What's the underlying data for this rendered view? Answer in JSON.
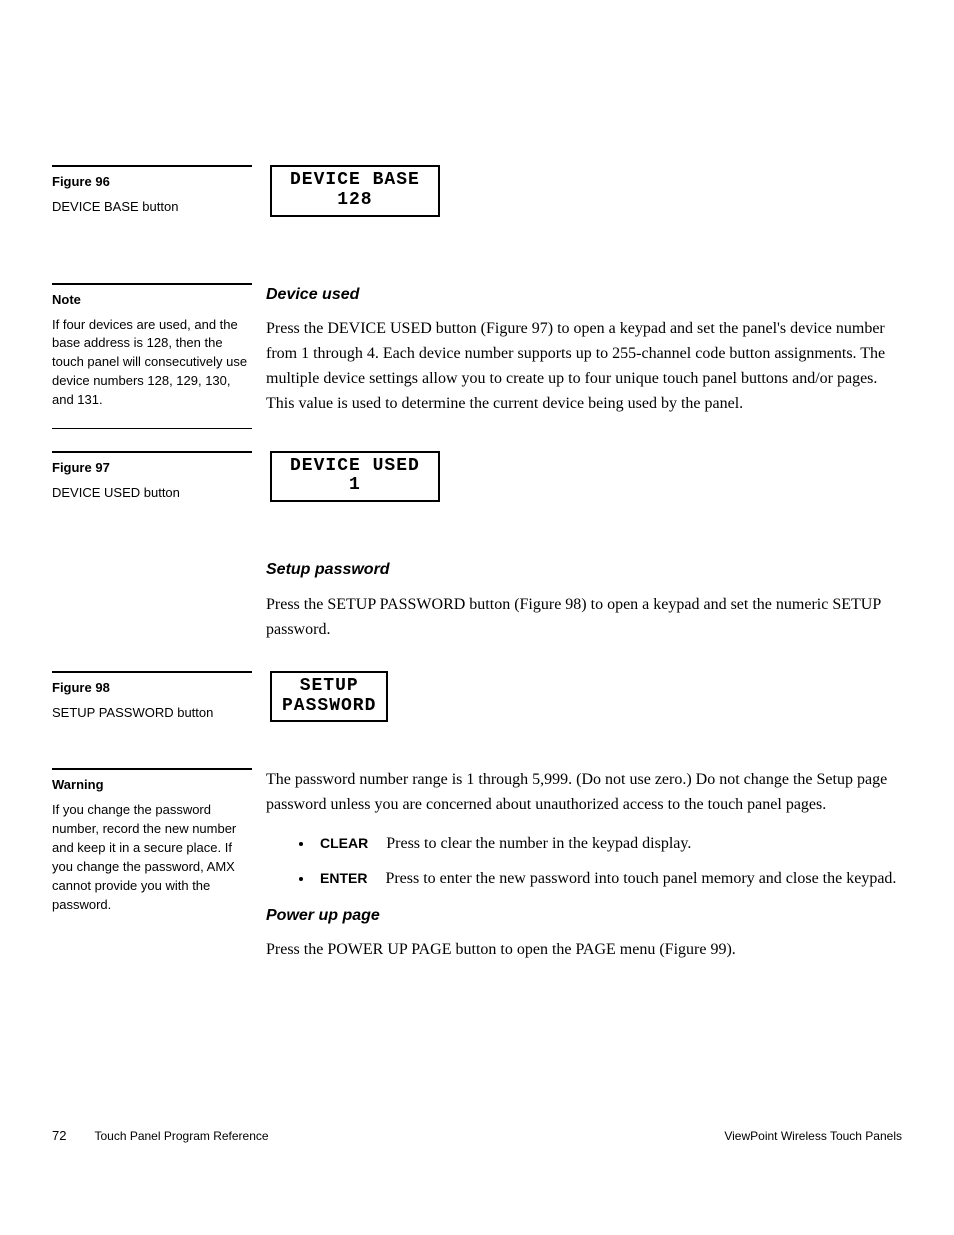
{
  "sidebar": {
    "fig96": {
      "label": "Figure 96",
      "caption": "DEVICE BASE button"
    },
    "note": {
      "label": "Note",
      "text": "If four devices are used, and the base address is 128, then the touch panel will consecutively use device numbers 128, 129, 130, and 131."
    },
    "fig97": {
      "label": "Figure 97",
      "caption": "DEVICE USED button"
    },
    "fig98": {
      "label": "Figure 98",
      "caption": "SETUP PASSWORD button"
    },
    "warning": {
      "label": "Warning",
      "text": "If you change the password number, record the new number and keep it in a secure place. If you change the password, AMX cannot provide you with the password."
    }
  },
  "figures": {
    "device_base": {
      "line1": "DEVICE BASE",
      "line2": "128"
    },
    "device_used": {
      "line1": "DEVICE USED",
      "line2": "1"
    },
    "setup_password": {
      "line1": "SETUP",
      "line2": "PASSWORD"
    }
  },
  "sections": {
    "device_used": {
      "title": "Device used",
      "para": "Press the DEVICE USED button (Figure 97) to open a keypad and set the panel's device number from 1 through 4. Each device number supports up to 255-channel code button assignments. The multiple device settings allow you to create up to four unique touch panel buttons and/or pages. This value is used to determine the current device being used by the panel."
    },
    "setup_password": {
      "title": "Setup password",
      "para1": "Press the SETUP PASSWORD button (Figure 98) to open a keypad and set the numeric SETUP password.",
      "para2": "The password number range is 1 through 5,999. (Do not use zero.) Do not change the Setup page password unless you are concerned about unauthorized access to the touch panel pages.",
      "bullets": {
        "clear": {
          "kw": "CLEAR",
          "text": "Press to clear the number in the keypad display."
        },
        "enter": {
          "kw": "ENTER",
          "text": "Press to enter the new password into touch panel memory and close the keypad."
        }
      }
    },
    "power_up": {
      "title": "Power up page",
      "para": "Press the POWER UP PAGE button to open the PAGE menu (Figure 99)."
    }
  },
  "footer": {
    "page": "72",
    "left": "Touch Panel Program Reference",
    "right": "ViewPoint Wireless Touch Panels"
  }
}
